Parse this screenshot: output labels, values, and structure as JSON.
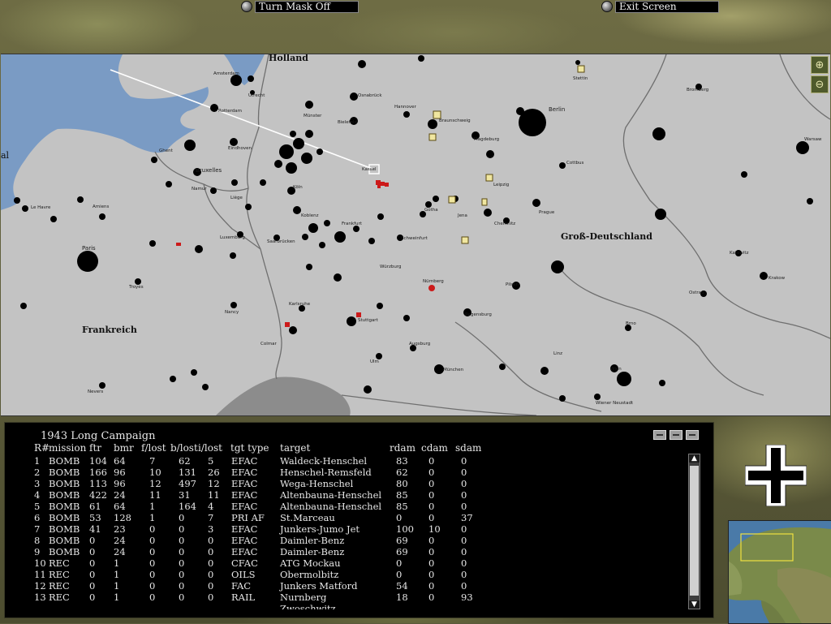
{
  "top_buttons": {
    "turn_mask": "Turn Mask Off",
    "exit": "Exit Screen"
  },
  "zoom": {
    "in_icon": "zoom-in-icon",
    "out_icon": "zoom-out-icon"
  },
  "map": {
    "regions": {
      "holland": "Holland",
      "germany": "Groß-Deutschland",
      "france": "Frankreich",
      "west_edge": "al"
    },
    "cities": {
      "amsterdam": "Amsterdam",
      "utrecht": "Utrecht",
      "rotterdam": "Rotterdam",
      "osnabruck": "Osnabrück",
      "munster": "Münster",
      "bielefeld": "Bielefeld",
      "hannover": "Hannover",
      "braunschweig": "Braunschweig",
      "magdeburg": "Magdeburg",
      "berlin": "Berlin",
      "stettin": "Stettin",
      "bromberg": "Bromberg",
      "warsaw": "Warsaw",
      "ghent": "Ghent",
      "bruxelles": "Bruxelles",
      "eindhoven": "Eindhoven",
      "namur": "Namur",
      "liege": "Liège",
      "koln": "Köln",
      "kassel": "Kassel",
      "cottbus": "Cottbus",
      "leipzig": "Leipzig",
      "gotha": "Gotha",
      "jena": "Jena",
      "chemnitz": "Chemnitz",
      "le_havre": "Le Havre",
      "amiens": "Amiens",
      "paris": "Paris",
      "koblenz": "Koblenz",
      "frankfurt": "Frankfurt",
      "luxemburg": "Luxemburg",
      "saarbrucken": "Saarbrücken",
      "wurzburg": "Würzburg",
      "schweinfurt": "Schweinfurt",
      "nurnberg": "Nürnberg",
      "pilsen": "Pilsen",
      "prague": "Prague",
      "katowitz": "Katowitz",
      "krakow": "Krakow",
      "ostrau": "Ostrau",
      "troyes": "Troyes",
      "nancy": "Nancy",
      "karlsruhe": "Karlsruhe",
      "stuttgart": "Stuttgart",
      "regensburg": "Regensburg",
      "ulm": "Ulm",
      "augsburg": "Augsburg",
      "munchen": "München",
      "colmar": "Colmar",
      "linz": "Linz",
      "wien": "Wien",
      "wiener_neustadt": "Wiener Neustadt",
      "brno": "Brno",
      "nevers": "Nevers"
    }
  },
  "campaign": {
    "title": "1943 Long Campaign",
    "headers": [
      "R#",
      "mission",
      "ftr",
      "bmr",
      "f/lost",
      "b/lost",
      "i/lost",
      "tgt type",
      "target",
      "rdam",
      "cdam",
      "sdam"
    ],
    "rows": [
      [
        "1",
        "BOMB",
        "104",
        "64",
        "7",
        "62",
        "5",
        "EFAC",
        "Waldeck-Henschel",
        "83",
        "0",
        "0"
      ],
      [
        "2",
        "BOMB",
        "166",
        "96",
        "10",
        "131",
        "26",
        "EFAC",
        "Henschel-Remsfeld",
        "62",
        "0",
        "0"
      ],
      [
        "3",
        "BOMB",
        "113",
        "96",
        "12",
        "497",
        "12",
        "EFAC",
        "Wega-Henschel",
        "80",
        "0",
        "0"
      ],
      [
        "4",
        "BOMB",
        "422",
        "24",
        "11",
        "31",
        "11",
        "EFAC",
        "Altenbauna-Henschel",
        "85",
        "0",
        "0"
      ],
      [
        "5",
        "BOMB",
        "61",
        "64",
        "1",
        "164",
        "4",
        "EFAC",
        "Altenbauna-Henschel",
        "85",
        "0",
        "0"
      ],
      [
        "6",
        "BOMB",
        "53",
        "128",
        "1",
        "0",
        "7",
        "PRI AF",
        "St.Marceau",
        "0",
        "0",
        "37"
      ],
      [
        "7",
        "BOMB",
        "41",
        "23",
        "0",
        "0",
        "3",
        "EFAC",
        "Junkers-Jumo Jet",
        "100",
        "10",
        "0"
      ],
      [
        "8",
        "BOMB",
        "0",
        "24",
        "0",
        "0",
        "0",
        "EFAC",
        "Daimler-Benz",
        "69",
        "0",
        "0"
      ],
      [
        "9",
        "BOMB",
        "0",
        "24",
        "0",
        "0",
        "0",
        "EFAC",
        "Daimler-Benz",
        "69",
        "0",
        "0"
      ],
      [
        "10",
        "REC",
        "0",
        "1",
        "0",
        "0",
        "0",
        "CFAC",
        "ATG Mockau",
        "0",
        "0",
        "0"
      ],
      [
        "11",
        "REC",
        "0",
        "1",
        "0",
        "0",
        "0",
        "OILS",
        "Obermolbitz",
        "0",
        "0",
        "0"
      ],
      [
        "12",
        "REC",
        "0",
        "1",
        "0",
        "0",
        "0",
        "FAC",
        "Junkers Matford",
        "54",
        "0",
        "0"
      ],
      [
        "13",
        "REC",
        "0",
        "1",
        "0",
        "0",
        "0",
        "RAIL",
        "Nurnberg",
        "18",
        "0",
        "93"
      ],
      [
        "",
        "",
        "",
        "",
        "",
        "",
        "",
        "",
        "Zwoschwitz",
        "",
        "",
        ""
      ]
    ]
  },
  "colors": {
    "map_land": "#c3c3c3",
    "sea": "#7a9bc4",
    "city": "#000000",
    "target": "#cc1a1a",
    "route": "#ffffff"
  }
}
